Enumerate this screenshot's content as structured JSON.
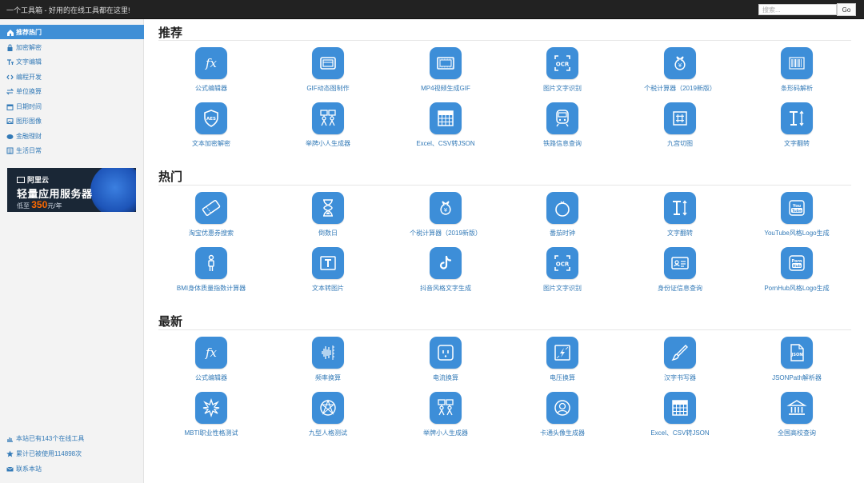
{
  "header": {
    "brand": "一个工具箱 - 好用的在线工具都在这里!",
    "search_placeholder": "搜索...",
    "go_label": "Go"
  },
  "sidebar": {
    "items": [
      {
        "label": "推荐热门",
        "icon": "home-icon",
        "active": true
      },
      {
        "label": "加密解密",
        "icon": "lock-icon"
      },
      {
        "label": "文字编辑",
        "icon": "text-icon"
      },
      {
        "label": "编程开发",
        "icon": "code-icon"
      },
      {
        "label": "单位换算",
        "icon": "exchange-icon"
      },
      {
        "label": "日期时间",
        "icon": "calendar-icon"
      },
      {
        "label": "图形图像",
        "icon": "image-icon"
      },
      {
        "label": "金融理财",
        "icon": "money-icon"
      },
      {
        "label": "生活日常",
        "icon": "list-icon"
      }
    ],
    "ad": {
      "brand": "阿里云",
      "title": "轻量应用服务器",
      "price_prefix": "低至",
      "price_value": "350",
      "price_suffix": "元/年"
    },
    "footer": [
      {
        "label": "本站已有143个在线工具",
        "icon": "chart-icon"
      },
      {
        "label": "累计已被使用114898次",
        "icon": "star-icon"
      },
      {
        "label": "联系本站",
        "icon": "mail-icon"
      }
    ]
  },
  "sections": [
    {
      "title": "推荐",
      "tools": [
        {
          "label": "公式编辑器",
          "icon": "formula-icon"
        },
        {
          "label": "GIF动态图制作",
          "icon": "gif-icon"
        },
        {
          "label": "MP4视频生成GIF",
          "icon": "video-icon"
        },
        {
          "label": "图片文字识别",
          "icon": "ocr-icon"
        },
        {
          "label": "个税计算器（2019新版）",
          "icon": "money-bag-icon"
        },
        {
          "label": "条形码解析",
          "icon": "barcode-icon"
        },
        {
          "label": "文本加密解密",
          "icon": "shield-aes-icon"
        },
        {
          "label": "举牌小人生成器",
          "icon": "sign-people-icon"
        },
        {
          "label": "Excel、CSV转JSON",
          "icon": "grid-icon"
        },
        {
          "label": "铁路信息查询",
          "icon": "train-icon"
        },
        {
          "label": "九宫切图",
          "icon": "nine-grid-icon"
        },
        {
          "label": "文字翻转",
          "icon": "flip-text-icon"
        }
      ]
    },
    {
      "title": "热门",
      "tools": [
        {
          "label": "淘宝优惠券搜索",
          "icon": "coupon-icon"
        },
        {
          "label": "倒数日",
          "icon": "hourglass-icon"
        },
        {
          "label": "个税计算器（2019新版）",
          "icon": "money-bag-icon"
        },
        {
          "label": "番茄时钟",
          "icon": "tomato-icon"
        },
        {
          "label": "文字翻转",
          "icon": "flip-text-icon"
        },
        {
          "label": "YouTube风格Logo生成",
          "icon": "youtube-logo-icon"
        },
        {
          "label": "BMI身体质量指数计算器",
          "icon": "person-icon"
        },
        {
          "label": "文本转图片",
          "icon": "text-image-icon"
        },
        {
          "label": "抖音风格文字生成",
          "icon": "tiktok-icon"
        },
        {
          "label": "图片文字识别",
          "icon": "ocr-icon"
        },
        {
          "label": "身份证信息查询",
          "icon": "id-card-icon"
        },
        {
          "label": "PornHub风格Logo生成",
          "icon": "ph-logo-icon"
        }
      ]
    },
    {
      "title": "最新",
      "tools": [
        {
          "label": "公式编辑器",
          "icon": "formula-icon"
        },
        {
          "label": "频率换算",
          "icon": "frequency-icon"
        },
        {
          "label": "电流换算",
          "icon": "socket-icon"
        },
        {
          "label": "电压换算",
          "icon": "voltage-icon"
        },
        {
          "label": "汉字书写器",
          "icon": "brush-icon"
        },
        {
          "label": "JSONPath解析器",
          "icon": "json-file-icon"
        },
        {
          "label": "MBTI职业性格测试",
          "icon": "mbti-icon"
        },
        {
          "label": "九型人格测试",
          "icon": "enneagram-icon"
        },
        {
          "label": "举牌小人生成器",
          "icon": "sign-people-icon"
        },
        {
          "label": "卡通头像生成器",
          "icon": "avatar-icon"
        },
        {
          "label": "Excel、CSV转JSON",
          "icon": "grid-icon"
        },
        {
          "label": "全国高校查询",
          "icon": "university-icon"
        }
      ]
    }
  ],
  "colors": {
    "accent": "#3d8ed8",
    "link": "#337ab7",
    "topbar": "#222222",
    "sidebar_bg": "#f3f3f3",
    "active_nav": "#3f8fd6"
  }
}
